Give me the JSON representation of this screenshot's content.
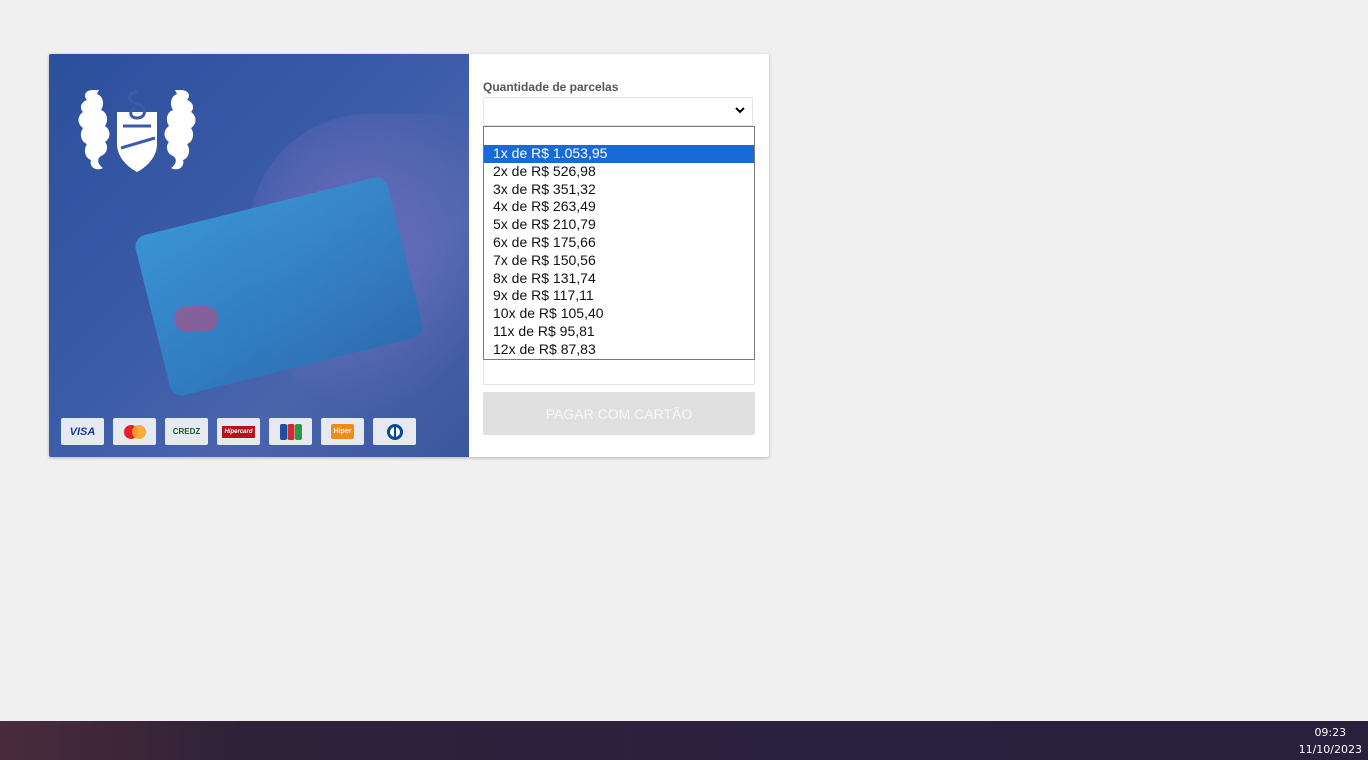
{
  "payment": {
    "installments_label": "Quantidade de parcelas",
    "installments_selected": "",
    "pay_button": "PAGAR COM CARTÃO",
    "options": [
      "1x de R$ 1.053,95",
      "2x de R$ 526,98",
      "3x de R$ 351,32",
      "4x de R$ 263,49",
      "5x de R$ 210,79",
      "6x de R$ 175,66",
      "7x de R$ 150,56",
      "8x de R$ 131,74",
      "9x de R$ 117,11",
      "10x de R$ 105,40",
      "11x de R$ 95,81",
      "12x de R$ 87,83"
    ],
    "highlighted_option_index": 0
  },
  "brands": {
    "visa": "VISA",
    "mastercard": "MasterCard",
    "credz": "CREDZ",
    "hipercard": "Hipercard",
    "jcb": "JCB",
    "hiper": "Hiper",
    "diners": "Diners Club"
  },
  "taskbar": {
    "time": "09:23",
    "date": "11/10/2023"
  },
  "colors": {
    "accent": "#1a6ad6",
    "hero_blue": "#3b5ba8",
    "button_disabled": "#e0e0e0"
  }
}
